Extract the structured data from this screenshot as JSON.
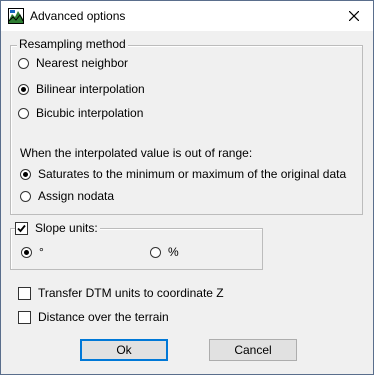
{
  "window": {
    "title": "Advanced options",
    "icon": "app-icon",
    "close_icon": "close-icon"
  },
  "resampling": {
    "group_title": "Resampling method",
    "options": [
      {
        "label": "Nearest neighbor",
        "checked": false
      },
      {
        "label": "Bilinear interpolation",
        "checked": true
      },
      {
        "label": "Bicubic interpolation",
        "checked": false
      }
    ],
    "out_of_range_label": "When the interpolated value is out of range:",
    "range_options": [
      {
        "label": "Saturates to the minimum or maximum of the original data",
        "checked": true
      },
      {
        "label": "Assign nodata",
        "checked": false
      }
    ]
  },
  "slope": {
    "checkbox_label": "Slope units:",
    "checked": true,
    "units": [
      {
        "label": "°",
        "checked": true
      },
      {
        "label": "%",
        "checked": false
      }
    ]
  },
  "options": {
    "transfer_label": "Transfer DTM units to coordinate Z",
    "transfer_checked": false,
    "distance_label": "Distance over the terrain",
    "distance_checked": false
  },
  "buttons": {
    "ok": "Ok",
    "cancel": "Cancel"
  }
}
